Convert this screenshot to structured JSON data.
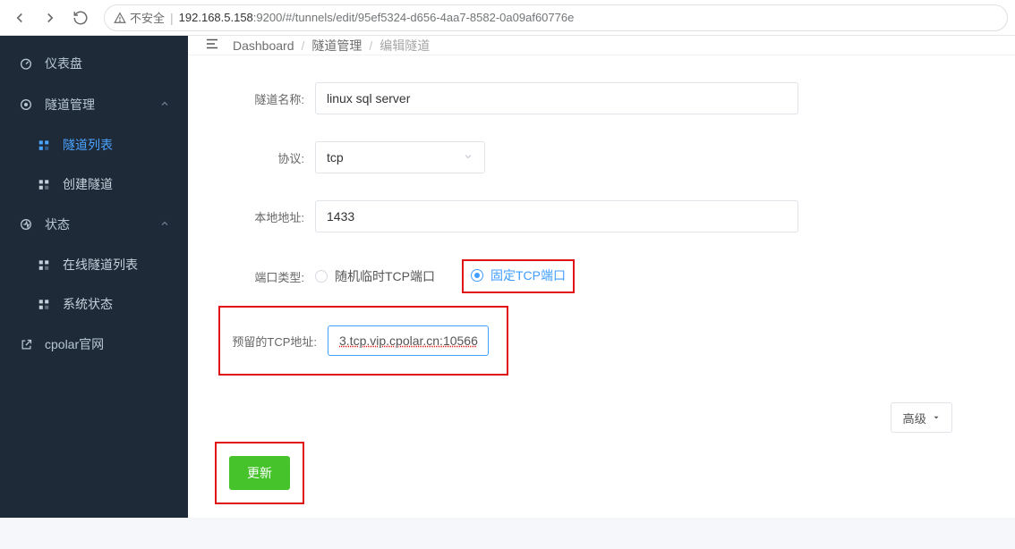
{
  "browser": {
    "security_label": "不安全",
    "url_host": "192.168.5.158",
    "url_rest": ":9200/#/tunnels/edit/95ef5324-d656-4aa7-8582-0a09af60776e"
  },
  "sidebar": {
    "dashboard": "仪表盘",
    "tunnel_group": "隧道管理",
    "tunnel_list": "隧道列表",
    "tunnel_create": "创建隧道",
    "status_group": "状态",
    "online_list": "在线隧道列表",
    "system_status": "系统状态",
    "cpolar_site": "cpolar官网"
  },
  "breadcrumbs": {
    "a": "Dashboard",
    "b": "隧道管理",
    "c": "编辑隧道"
  },
  "form": {
    "name_label": "隧道名称:",
    "name_value": "linux sql server",
    "proto_label": "协议:",
    "proto_value": "tcp",
    "local_label": "本地地址:",
    "local_value": "1433",
    "port_type_label": "端口类型:",
    "port_random": "随机临时TCP端口",
    "port_fixed": "固定TCP端口",
    "reserved_label": "预留的TCP地址:",
    "reserved_value": "3.tcp.vip.cpolar.cn:10566",
    "advanced": "高级",
    "submit": "更新"
  }
}
